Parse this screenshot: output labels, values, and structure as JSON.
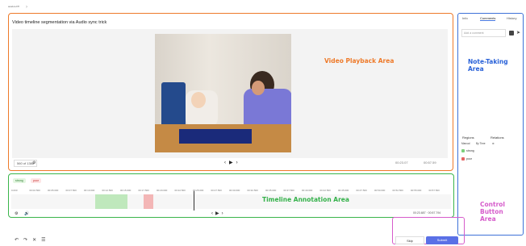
{
  "breadcrumb": "aoa1ce47f",
  "task_title": "Video timeline segmentation via Audio sync trick",
  "video": {
    "frame_text": "560 of 1388",
    "time_left": "00:23.07",
    "time_right": "00:57.59"
  },
  "right_panel": {
    "tabs": [
      "Info",
      "Comments",
      "History"
    ],
    "comment_placeholder": "Add a comment",
    "regions_tabs": [
      "Regions",
      "Relations"
    ],
    "filters": [
      "Manual",
      "By Time",
      "⚙"
    ],
    "regions": [
      {
        "label": "strong",
        "color": "#7dcf7d"
      },
      {
        "label": "poor",
        "color": "#e46464"
      }
    ]
  },
  "timeline": {
    "labels": [
      {
        "text": "strong",
        "bg": "#e3f6e1",
        "fg": "#2e7d32"
      },
      {
        "text": "poor",
        "bg": "#fde6e6",
        "fg": "#c62828"
      }
    ],
    "ticks": [
      "0.000",
      "00:02.500",
      "00:05.000",
      "00:07.500",
      "00:10.000",
      "00:12.500",
      "00:15.000",
      "00:17.500",
      "00:20.000",
      "00:22.500",
      "00:25.000",
      "00:27.500",
      "00:30.000",
      "00:32.500",
      "00:35.000",
      "00:37.500",
      "00:40.000",
      "00:42.500",
      "00:45.000",
      "00:47.500",
      "00:50.000",
      "00:52.500",
      "00:55.000",
      "00:57.500"
    ],
    "time_readout": "00:23.687 · 00:57.794"
  },
  "controls": {
    "skip": "Skip",
    "submit": "Submit"
  },
  "annotations": {
    "video": "Video Playback Area",
    "note": "Note-Taking\nArea",
    "timeline": "Timeline Annotation Area",
    "control": "Control Button\nArea"
  }
}
